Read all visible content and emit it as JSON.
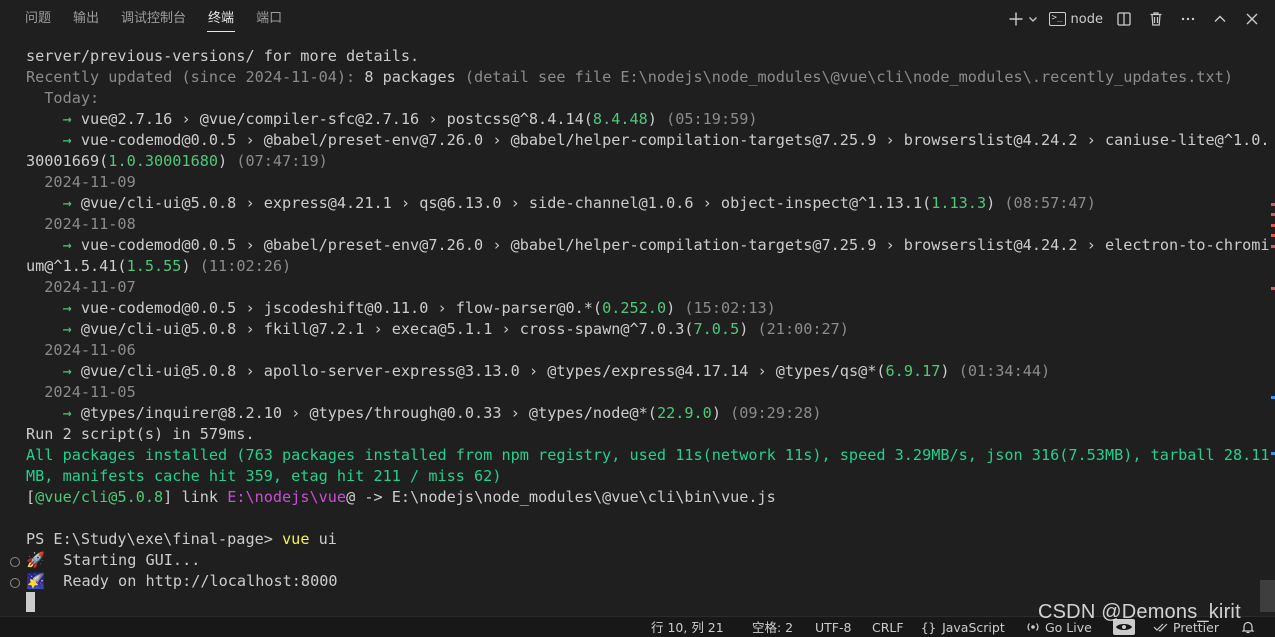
{
  "panel": {
    "tabs": [
      {
        "label": "问题",
        "active": false
      },
      {
        "label": "输出",
        "active": false
      },
      {
        "label": "调试控制台",
        "active": false
      },
      {
        "label": "终端",
        "active": true
      },
      {
        "label": "端口",
        "active": false
      }
    ],
    "actions": {
      "new_terminal_icon": "plus-icon",
      "dropdown_icon": "chevron-down-icon",
      "terminal_label": "node",
      "split_icon": "split-icon",
      "kill_icon": "trash-icon",
      "more_icon": "ellipsis-icon",
      "maximize_icon": "chevron-up-icon",
      "close_icon": "close-icon"
    }
  },
  "terminal": {
    "lines": [
      [
        {
          "t": "server/previous-versions/ for more details.",
          "c": "normal"
        }
      ],
      [
        {
          "t": "Recently updated (since 2024-11-04): ",
          "c": "dim"
        },
        {
          "t": "8 packages",
          "c": "normal"
        },
        {
          "t": " (detail see file E:\\nodejs\\node_modules\\@vue\\cli\\node_modules\\.recently_updates.txt)",
          "c": "dim"
        }
      ],
      [
        {
          "t": "  Today:",
          "c": "dim"
        }
      ],
      [
        {
          "t": "    → ",
          "c": "greenish"
        },
        {
          "t": "vue@2.7.16 › @vue/compiler-sfc@2.7.16 › postcss@^8.4.14(",
          "c": "normal"
        },
        {
          "t": "8.4.48",
          "c": "greenish"
        },
        {
          "t": ") ",
          "c": "normal"
        },
        {
          "t": "(05:19:59)",
          "c": "dim"
        }
      ],
      [
        {
          "t": "    → ",
          "c": "greenish"
        },
        {
          "t": "vue-codemod@0.0.5 › @babel/preset-env@7.26.0 › @babel/helper-compilation-targets@7.25.9 › browserslist@4.24.2 › caniuse-lite@^1.0.",
          "c": "normal"
        }
      ],
      [
        {
          "t": "30001669(",
          "c": "normal"
        },
        {
          "t": "1.0.30001680",
          "c": "greenish"
        },
        {
          "t": ") ",
          "c": "normal"
        },
        {
          "t": "(07:47:19)",
          "c": "dim"
        }
      ],
      [
        {
          "t": "  2024-11-09",
          "c": "dim"
        }
      ],
      [
        {
          "t": "    → ",
          "c": "greenish"
        },
        {
          "t": "@vue/cli-ui@5.0.8 › express@4.21.1 › qs@6.13.0 › side-channel@1.0.6 › object-inspect@^1.13.1(",
          "c": "normal"
        },
        {
          "t": "1.13.3",
          "c": "greenish"
        },
        {
          "t": ") ",
          "c": "normal"
        },
        {
          "t": "(08:57:47)",
          "c": "dim"
        }
      ],
      [
        {
          "t": "  2024-11-08",
          "c": "dim"
        }
      ],
      [
        {
          "t": "    → ",
          "c": "greenish"
        },
        {
          "t": "vue-codemod@0.0.5 › @babel/preset-env@7.26.0 › @babel/helper-compilation-targets@7.25.9 › browserslist@4.24.2 › electron-to-chromi",
          "c": "normal"
        }
      ],
      [
        {
          "t": "um@^1.5.41(",
          "c": "normal"
        },
        {
          "t": "1.5.55",
          "c": "greenish"
        },
        {
          "t": ") ",
          "c": "normal"
        },
        {
          "t": "(11:02:26)",
          "c": "dim"
        }
      ],
      [
        {
          "t": "  2024-11-07",
          "c": "dim"
        }
      ],
      [
        {
          "t": "    → ",
          "c": "greenish"
        },
        {
          "t": "vue-codemod@0.0.5 › jscodeshift@0.11.0 › flow-parser@0.*(",
          "c": "normal"
        },
        {
          "t": "0.252.0",
          "c": "greenish"
        },
        {
          "t": ") ",
          "c": "normal"
        },
        {
          "t": "(15:02:13)",
          "c": "dim"
        }
      ],
      [
        {
          "t": "    → ",
          "c": "greenish"
        },
        {
          "t": "@vue/cli-ui@5.0.8 › fkill@7.2.1 › execa@5.1.1 › cross-spawn@^7.0.3(",
          "c": "normal"
        },
        {
          "t": "7.0.5",
          "c": "greenish"
        },
        {
          "t": ") ",
          "c": "normal"
        },
        {
          "t": "(21:00:27)",
          "c": "dim"
        }
      ],
      [
        {
          "t": "  2024-11-06",
          "c": "dim"
        }
      ],
      [
        {
          "t": "    → ",
          "c": "greenish"
        },
        {
          "t": "@vue/cli-ui@5.0.8 › apollo-server-express@3.13.0 › @types/express@4.17.14 › @types/qs@*(",
          "c": "normal"
        },
        {
          "t": "6.9.17",
          "c": "greenish"
        },
        {
          "t": ") ",
          "c": "normal"
        },
        {
          "t": "(01:34:44)",
          "c": "dim"
        }
      ],
      [
        {
          "t": "  2024-11-05",
          "c": "dim"
        }
      ],
      [
        {
          "t": "    → ",
          "c": "greenish"
        },
        {
          "t": "@types/inquirer@8.2.10 › @types/through@0.0.33 › @types/node@*(",
          "c": "normal"
        },
        {
          "t": "22.9.0",
          "c": "greenish"
        },
        {
          "t": ") ",
          "c": "normal"
        },
        {
          "t": "(09:29:28)",
          "c": "dim"
        }
      ],
      [
        {
          "t": "Run 2 script(s) in 579ms.",
          "c": "normal"
        }
      ],
      [
        {
          "t": "All packages installed (763 packages installed from npm registry, used 11s(network 11s), speed 3.29MB/s, json 316(7.53MB), tarball 28.11",
          "c": "green"
        }
      ],
      [
        {
          "t": "MB, manifests cache hit 359, etag hit 211 / miss 62)",
          "c": "green"
        }
      ],
      [
        {
          "t": "[",
          "c": "normal"
        },
        {
          "t": "@vue/cli@5.0.8",
          "c": "greenish"
        },
        {
          "t": "] link ",
          "c": "normal"
        },
        {
          "t": "E:\\nodejs\\vue",
          "c": "magenta"
        },
        {
          "t": "@ -> E:\\nodejs\\node_modules\\@vue\\cli\\bin\\vue.js",
          "c": "normal"
        }
      ],
      [
        {
          "t": "",
          "c": "normal"
        }
      ],
      [
        {
          "t": "PS E:\\Study\\exe\\final-page> ",
          "c": "normal"
        },
        {
          "t": "vue",
          "c": "yellow"
        },
        {
          "t": " ui",
          "c": "normal"
        }
      ],
      [
        {
          "t": "🚀  Starting GUI...",
          "c": "normal"
        }
      ],
      [
        {
          "t": "🌠  Ready on http://localhost:8000",
          "c": "normal"
        }
      ]
    ]
  },
  "status_bar": {
    "position": "行 10, 列 21",
    "indent": "空格: 2",
    "encoding": "UTF-8",
    "eol": "CRLF",
    "language": "JavaScript",
    "language_icon": "braces-icon",
    "go_live": "Go Live",
    "go_live_icon": "radio-tower-icon",
    "prettier": "Prettier",
    "prettier_icon": "double-check-icon",
    "bell_icon": "bell-icon"
  },
  "watermark": "CSDN @Demons_kirit",
  "colors": {
    "background": "#1f1f1f",
    "foreground": "#cccccc",
    "dim": "#8b8b8b",
    "green": "#23d18b",
    "yellow": "#f5f543",
    "magenta": "#c94fd0"
  }
}
